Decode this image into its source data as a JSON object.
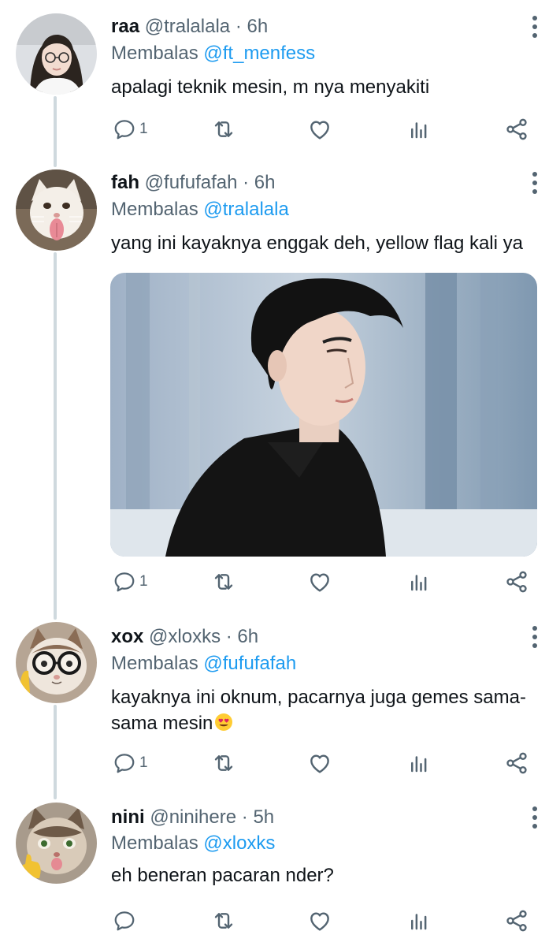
{
  "replying_prefix": "Membalas",
  "colors": {
    "accent": "#1d9bf0",
    "text_primary": "#0f1419",
    "text_secondary": "#536471",
    "thread_line": "#cfd9de"
  },
  "tweets": [
    {
      "name": "raa",
      "handle": "@tralalala",
      "separator": "·",
      "time": "6h",
      "replying_to": "@ft_menfess",
      "text": "apalagi teknik mesin, m nya menyakiti",
      "reply_count": "1",
      "avatar_icon": "profile-photo",
      "actions": [
        "reply-icon",
        "retweet-icon",
        "like-icon",
        "analytics-icon",
        "share-icon"
      ]
    },
    {
      "name": "fah",
      "handle": "@fufufafah",
      "separator": "·",
      "time": "6h",
      "replying_to": "@tralalala",
      "text": "yang ini kayaknya enggak deh, yellow flag kali ya",
      "reply_count": "1",
      "avatar_icon": "cat-photo",
      "media": "photo-of-man-in-black-shirt",
      "actions": [
        "reply-icon",
        "retweet-icon",
        "like-icon",
        "analytics-icon",
        "share-icon"
      ]
    },
    {
      "name": "xox",
      "handle": "@xloxks",
      "separator": "·",
      "time": "6h",
      "replying_to": "@fufufafah",
      "text_line1": "kayaknya ini oknum, pacarnya juga gemes sama-",
      "text_line2": "sama mesin",
      "emoji": "heart-eyes-emoji",
      "reply_count": "1",
      "avatar_icon": "cat-with-glasses-photo",
      "actions": [
        "reply-icon",
        "retweet-icon",
        "like-icon",
        "analytics-icon",
        "share-icon"
      ]
    },
    {
      "name": "nini",
      "handle": "@ninihere",
      "separator": "·",
      "time": "5h",
      "replying_to": "@xloxks",
      "text": "eh beneran pacaran nder?",
      "reply_count": "",
      "avatar_icon": "cat-thumbs-up-photo",
      "actions": [
        "reply-icon",
        "retweet-icon",
        "like-icon",
        "analytics-icon",
        "share-icon"
      ]
    }
  ]
}
